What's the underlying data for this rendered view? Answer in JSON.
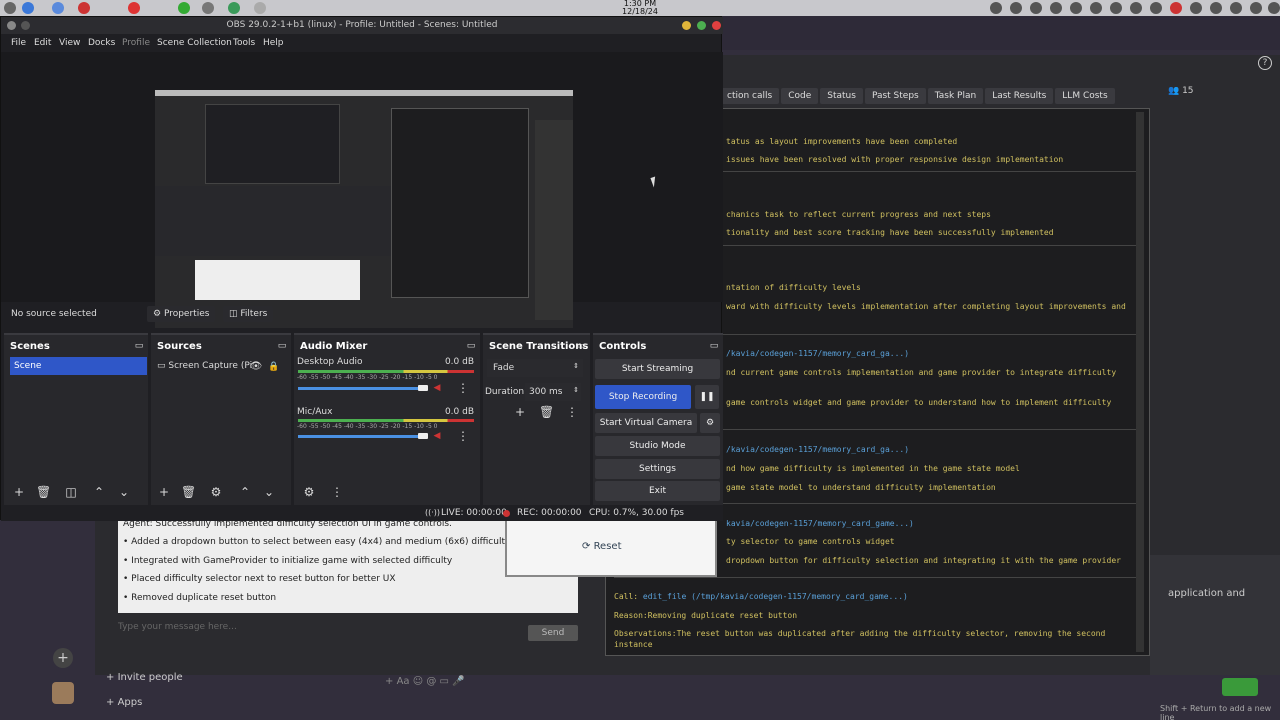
{
  "system": {
    "clock_time": "1:30 PM",
    "clock_date": "12/18/24"
  },
  "obs": {
    "title": "OBS 29.0.2-1+b1 (linux) - Profile: Untitled - Scenes: Untitled",
    "menu": [
      "File",
      "Edit",
      "View",
      "Docks",
      "Profile",
      "Scene Collection",
      "Tools",
      "Help"
    ],
    "source_status": "No source selected",
    "properties_label": "Properties",
    "filters_label": "Filters",
    "scenes": {
      "header": "Scenes",
      "items": [
        "Scene"
      ]
    },
    "sources": {
      "header": "Sources",
      "items": [
        "Screen Capture (Pi"
      ]
    },
    "audio": {
      "header": "Audio Mixer",
      "tracks": [
        {
          "name": "Desktop Audio",
          "db": "0.0 dB"
        },
        {
          "name": "Mic/Aux",
          "db": "0.0 dB"
        }
      ],
      "scale": "-60 -55 -50 -45 -40 -35 -30 -25 -20 -15 -10 -5 0"
    },
    "transitions": {
      "header": "Scene Transitions",
      "type": "Fade",
      "duration_label": "Duration",
      "duration_value": "300 ms"
    },
    "controls": {
      "header": "Controls",
      "start_streaming": "Start Streaming",
      "stop_recording": "Stop Recording",
      "start_virtual_camera": "Start Virtual Camera",
      "studio_mode": "Studio Mode",
      "settings": "Settings",
      "exit": "Exit"
    },
    "status": {
      "live": "LIVE: 00:00:00",
      "rec": "REC: 00:00:00",
      "cpu": "CPU: 0.7%, 30.00 fps"
    }
  },
  "background": {
    "tabs": [
      "ction calls",
      "Code",
      "Status",
      "Past Steps",
      "Task Plan",
      "Last Results",
      "LLM Costs"
    ],
    "count": "15",
    "terminal_lines": [
      "tatus as layout improvements have been completed",
      "issues have been resolved with proper responsive design implementation",
      "chanics task to reflect current progress and next steps",
      "tionality and best score tracking have been successfully implemented",
      "ntation of difficulty levels",
      "ward with difficulty levels implementation after completing layout improvements and",
      "/kavia/codegen-1157/memory_card_ga...)",
      "nd current game controls implementation and game provider to integrate difficulty",
      "game controls widget and game provider to understand how to implement difficulty",
      "/kavia/codegen-1157/memory_card_ga...)",
      "nd how game difficulty is implemented in the game state model",
      "game state model to understand difficulty implementation",
      "kavia/codegen-1157/memory_card_game...)",
      "ty selector to game controls widget",
      "dropdown button for difficulty selection and integrating it with the game provider"
    ],
    "last_call": {
      "call_label": "Call:",
      "call_text": "edit_file (/tmp/kavia/codegen-1157/memory_card_game...)",
      "reason_label": "Reason:",
      "reason_text": "Removing duplicate reset button",
      "obs_label": "Observations:",
      "obs_text": "The reset button was duplicated after adding the difficulty selector, removing the second",
      "obs_text2": "instance"
    },
    "chat": [
      "Agent: Successfully implemented difficulty selection UI in game controls.",
      "• Added a dropdown button to select between easy (4x4) and medium (6x6) difficulties",
      "• Integrated with GameProvider to initialize game with selected difficulty",
      "• Placed difficulty selector next to reset button for better UX",
      "• Removed duplicate reset button"
    ],
    "chat_placeholder": "Type your message here...",
    "send": "Send",
    "reset": "Reset",
    "invite": "Invite people",
    "apps": "Apps",
    "right_text": "application and",
    "hint": "Shift + Return to add a new line"
  }
}
